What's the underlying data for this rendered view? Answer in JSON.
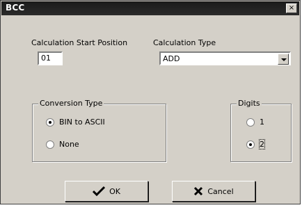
{
  "window": {
    "title": "BCC",
    "close_glyph": "×"
  },
  "calc_start": {
    "label": "Calculation Start Position",
    "value": "01"
  },
  "calc_type": {
    "label": "Calculation Type",
    "value": "ADD"
  },
  "conversion": {
    "legend": "Conversion Type",
    "options": [
      "BIN to ASCII",
      "None"
    ],
    "selected_index": 0
  },
  "digits": {
    "legend": "Digits",
    "options": [
      "1",
      "2"
    ],
    "selected_index": 1
  },
  "buttons": {
    "ok": "OK",
    "cancel": "Cancel"
  },
  "icons": {
    "ok": "checkmark-icon",
    "cancel": "x-mark-icon"
  }
}
